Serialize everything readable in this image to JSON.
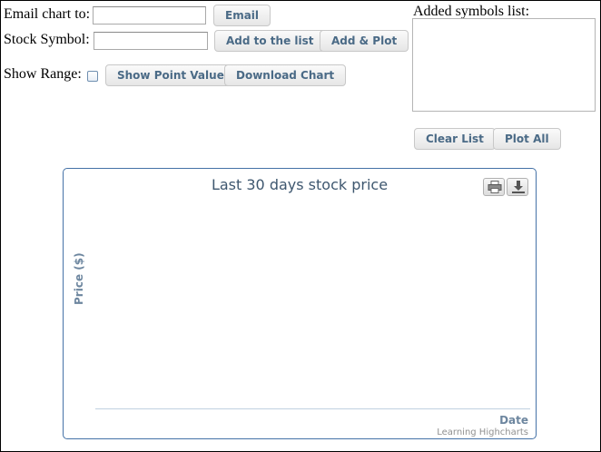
{
  "form": {
    "email_label": "Email chart to:",
    "email_value": "",
    "email_button": "Email",
    "symbol_label": "Stock Symbol:",
    "symbol_value": "",
    "add_button": "Add to the list",
    "add_plot_button": "Add & Plot",
    "range_label": "Show Range:",
    "range_checked": false,
    "point_value_button": "Show Point Value",
    "download_button": "Download Chart"
  },
  "symbols": {
    "title": "Added symbols list:",
    "items": [],
    "clear_button": "Clear List",
    "plot_all_button": "Plot All"
  },
  "chart_data": {
    "type": "line",
    "title": "Last 30 days stock price",
    "xlabel": "Date",
    "ylabel": "Price ($)",
    "series": [],
    "credits": "Learning Highcharts",
    "buttons": [
      "print-icon",
      "download-icon"
    ],
    "grid": false
  }
}
